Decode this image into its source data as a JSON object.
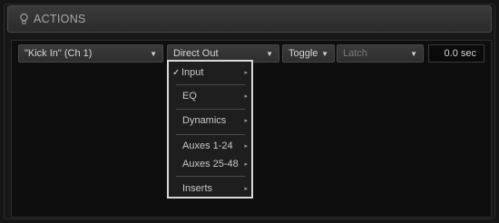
{
  "header": {
    "title": "ACTIONS"
  },
  "action_row": {
    "source": "\"Kick In\" (Ch 1)",
    "target": "Direct Out",
    "mode": "Toggle",
    "latch": "Latch",
    "time": "0.0 sec"
  },
  "menu": {
    "items": [
      {
        "label": "Input",
        "checked": "✓",
        "chevron": "▸"
      },
      {
        "label": "EQ",
        "chevron": "▸"
      },
      {
        "label": "Dynamics",
        "chevron": "▸"
      },
      {
        "label": "Auxes 1-24",
        "chevron": "▸"
      },
      {
        "label": "Auxes 25-48",
        "chevron": "▸"
      },
      {
        "label": "Inserts",
        "chevron": "▸"
      }
    ]
  },
  "icons": {
    "header": "lightbulb-icon",
    "dropdown": "triangle-down-icon",
    "submenu": "chevron-right-icon"
  },
  "colors": {
    "highlight_border": "#d9d9d9",
    "background": "#151515"
  }
}
